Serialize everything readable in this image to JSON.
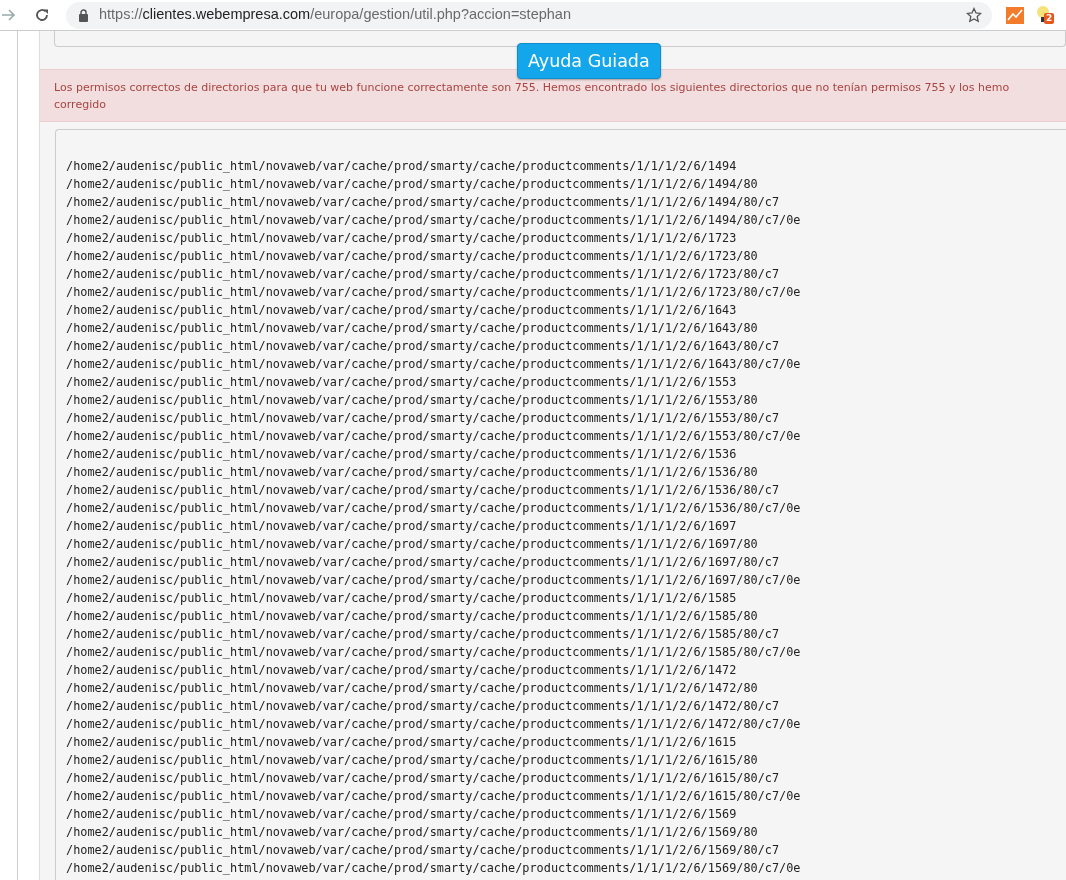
{
  "browser": {
    "url_scheme": "https://",
    "url_host": "clientes.webempresa.com",
    "url_path": "/europa/gestion/util.php?accion=stephan",
    "extension_badge": "2"
  },
  "help_button": "Ayuda Guiada",
  "alert_lines": [
    "Los permisos correctos de directorios para que tu web funcione correctamente son 755. Hemos encontrado los siguientes directorios que no tenían permisos 755 y los hemo",
    "corregido"
  ],
  "directories": [
    "/home2/audenisc/public_html/novaweb/var/cache/prod/smarty/cache/productcomments/1/1/1/2/6/1494",
    "/home2/audenisc/public_html/novaweb/var/cache/prod/smarty/cache/productcomments/1/1/1/2/6/1494/80",
    "/home2/audenisc/public_html/novaweb/var/cache/prod/smarty/cache/productcomments/1/1/1/2/6/1494/80/c7",
    "/home2/audenisc/public_html/novaweb/var/cache/prod/smarty/cache/productcomments/1/1/1/2/6/1494/80/c7/0e",
    "/home2/audenisc/public_html/novaweb/var/cache/prod/smarty/cache/productcomments/1/1/1/2/6/1723",
    "/home2/audenisc/public_html/novaweb/var/cache/prod/smarty/cache/productcomments/1/1/1/2/6/1723/80",
    "/home2/audenisc/public_html/novaweb/var/cache/prod/smarty/cache/productcomments/1/1/1/2/6/1723/80/c7",
    "/home2/audenisc/public_html/novaweb/var/cache/prod/smarty/cache/productcomments/1/1/1/2/6/1723/80/c7/0e",
    "/home2/audenisc/public_html/novaweb/var/cache/prod/smarty/cache/productcomments/1/1/1/2/6/1643",
    "/home2/audenisc/public_html/novaweb/var/cache/prod/smarty/cache/productcomments/1/1/1/2/6/1643/80",
    "/home2/audenisc/public_html/novaweb/var/cache/prod/smarty/cache/productcomments/1/1/1/2/6/1643/80/c7",
    "/home2/audenisc/public_html/novaweb/var/cache/prod/smarty/cache/productcomments/1/1/1/2/6/1643/80/c7/0e",
    "/home2/audenisc/public_html/novaweb/var/cache/prod/smarty/cache/productcomments/1/1/1/2/6/1553",
    "/home2/audenisc/public_html/novaweb/var/cache/prod/smarty/cache/productcomments/1/1/1/2/6/1553/80",
    "/home2/audenisc/public_html/novaweb/var/cache/prod/smarty/cache/productcomments/1/1/1/2/6/1553/80/c7",
    "/home2/audenisc/public_html/novaweb/var/cache/prod/smarty/cache/productcomments/1/1/1/2/6/1553/80/c7/0e",
    "/home2/audenisc/public_html/novaweb/var/cache/prod/smarty/cache/productcomments/1/1/1/2/6/1536",
    "/home2/audenisc/public_html/novaweb/var/cache/prod/smarty/cache/productcomments/1/1/1/2/6/1536/80",
    "/home2/audenisc/public_html/novaweb/var/cache/prod/smarty/cache/productcomments/1/1/1/2/6/1536/80/c7",
    "/home2/audenisc/public_html/novaweb/var/cache/prod/smarty/cache/productcomments/1/1/1/2/6/1536/80/c7/0e",
    "/home2/audenisc/public_html/novaweb/var/cache/prod/smarty/cache/productcomments/1/1/1/2/6/1697",
    "/home2/audenisc/public_html/novaweb/var/cache/prod/smarty/cache/productcomments/1/1/1/2/6/1697/80",
    "/home2/audenisc/public_html/novaweb/var/cache/prod/smarty/cache/productcomments/1/1/1/2/6/1697/80/c7",
    "/home2/audenisc/public_html/novaweb/var/cache/prod/smarty/cache/productcomments/1/1/1/2/6/1697/80/c7/0e",
    "/home2/audenisc/public_html/novaweb/var/cache/prod/smarty/cache/productcomments/1/1/1/2/6/1585",
    "/home2/audenisc/public_html/novaweb/var/cache/prod/smarty/cache/productcomments/1/1/1/2/6/1585/80",
    "/home2/audenisc/public_html/novaweb/var/cache/prod/smarty/cache/productcomments/1/1/1/2/6/1585/80/c7",
    "/home2/audenisc/public_html/novaweb/var/cache/prod/smarty/cache/productcomments/1/1/1/2/6/1585/80/c7/0e",
    "/home2/audenisc/public_html/novaweb/var/cache/prod/smarty/cache/productcomments/1/1/1/2/6/1472",
    "/home2/audenisc/public_html/novaweb/var/cache/prod/smarty/cache/productcomments/1/1/1/2/6/1472/80",
    "/home2/audenisc/public_html/novaweb/var/cache/prod/smarty/cache/productcomments/1/1/1/2/6/1472/80/c7",
    "/home2/audenisc/public_html/novaweb/var/cache/prod/smarty/cache/productcomments/1/1/1/2/6/1472/80/c7/0e",
    "/home2/audenisc/public_html/novaweb/var/cache/prod/smarty/cache/productcomments/1/1/1/2/6/1615",
    "/home2/audenisc/public_html/novaweb/var/cache/prod/smarty/cache/productcomments/1/1/1/2/6/1615/80",
    "/home2/audenisc/public_html/novaweb/var/cache/prod/smarty/cache/productcomments/1/1/1/2/6/1615/80/c7",
    "/home2/audenisc/public_html/novaweb/var/cache/prod/smarty/cache/productcomments/1/1/1/2/6/1615/80/c7/0e",
    "/home2/audenisc/public_html/novaweb/var/cache/prod/smarty/cache/productcomments/1/1/1/2/6/1569",
    "/home2/audenisc/public_html/novaweb/var/cache/prod/smarty/cache/productcomments/1/1/1/2/6/1569/80",
    "/home2/audenisc/public_html/novaweb/var/cache/prod/smarty/cache/productcomments/1/1/1/2/6/1569/80/c7",
    "/home2/audenisc/public_html/novaweb/var/cache/prod/smarty/cache/productcomments/1/1/1/2/6/1569/80/c7/0e"
  ]
}
